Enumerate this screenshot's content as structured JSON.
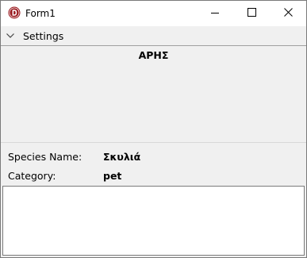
{
  "window": {
    "title": "Form1",
    "icon": "delphi-app-icon",
    "accent": "#9b1b20"
  },
  "caption_buttons": {
    "minimize": "minimize-icon",
    "maximize": "maximize-icon",
    "close": "close-icon"
  },
  "settings": {
    "label": "Settings",
    "icon": "chevron-down-icon"
  },
  "pet": {
    "name": "ΑΡΗΣ",
    "species_label": "Species Name:",
    "species_value": "Σκυλιά",
    "category_label": "Category:",
    "category_value": "pet"
  }
}
